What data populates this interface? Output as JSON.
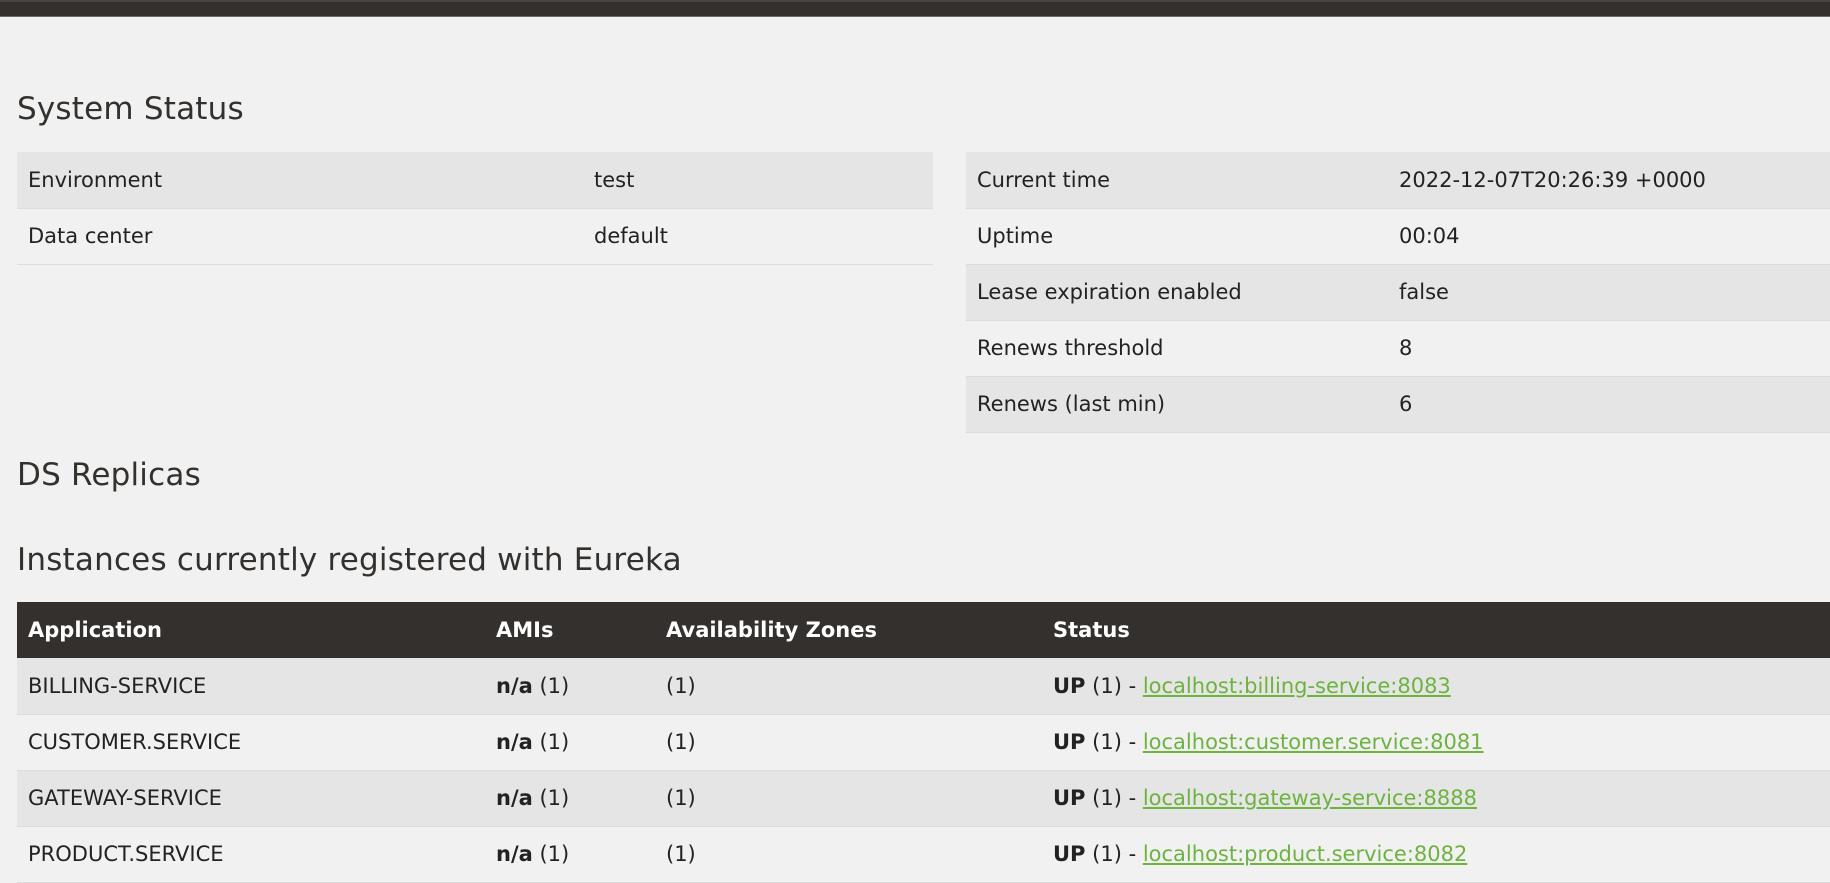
{
  "headings": {
    "system_status": "System Status",
    "ds_replicas": "DS Replicas",
    "instances": "Instances currently registered with Eureka"
  },
  "environment_table": [
    {
      "label": "Environment",
      "value": "test"
    },
    {
      "label": "Data center",
      "value": "default"
    }
  ],
  "status_table": [
    {
      "label": "Current time",
      "value": "2022-12-07T20:26:39 +0000"
    },
    {
      "label": "Uptime",
      "value": "00:04"
    },
    {
      "label": "Lease expiration enabled",
      "value": "false"
    },
    {
      "label": "Renews threshold",
      "value": "8"
    },
    {
      "label": "Renews (last min)",
      "value": "6"
    }
  ],
  "instances": {
    "columns": [
      "Application",
      "AMIs",
      "Availability Zones",
      "Status"
    ],
    "rows": [
      {
        "application": "BILLING-SERVICE",
        "amis_value": "n/a",
        "amis_count": "(1)",
        "zones": "(1)",
        "status": "UP",
        "status_count": "(1) -",
        "link": "localhost:billing-service:8083"
      },
      {
        "application": "CUSTOMER.SERVICE",
        "amis_value": "n/a",
        "amis_count": "(1)",
        "zones": "(1)",
        "status": "UP",
        "status_count": "(1) -",
        "link": "localhost:customer.service:8081"
      },
      {
        "application": "GATEWAY-SERVICE",
        "amis_value": "n/a",
        "amis_count": "(1)",
        "zones": "(1)",
        "status": "UP",
        "status_count": "(1) -",
        "link": "localhost:gateway-service:8888"
      },
      {
        "application": "PRODUCT.SERVICE",
        "amis_value": "n/a",
        "amis_count": "(1)",
        "zones": "(1)",
        "status": "UP",
        "status_count": "(1) -",
        "link": "localhost:product.service:8082"
      }
    ]
  },
  "colors": {
    "header_bg": "#34302d",
    "link": "#6db33f",
    "row_alt": "#e5e5e5",
    "page_bg": "#f1f1f1"
  }
}
